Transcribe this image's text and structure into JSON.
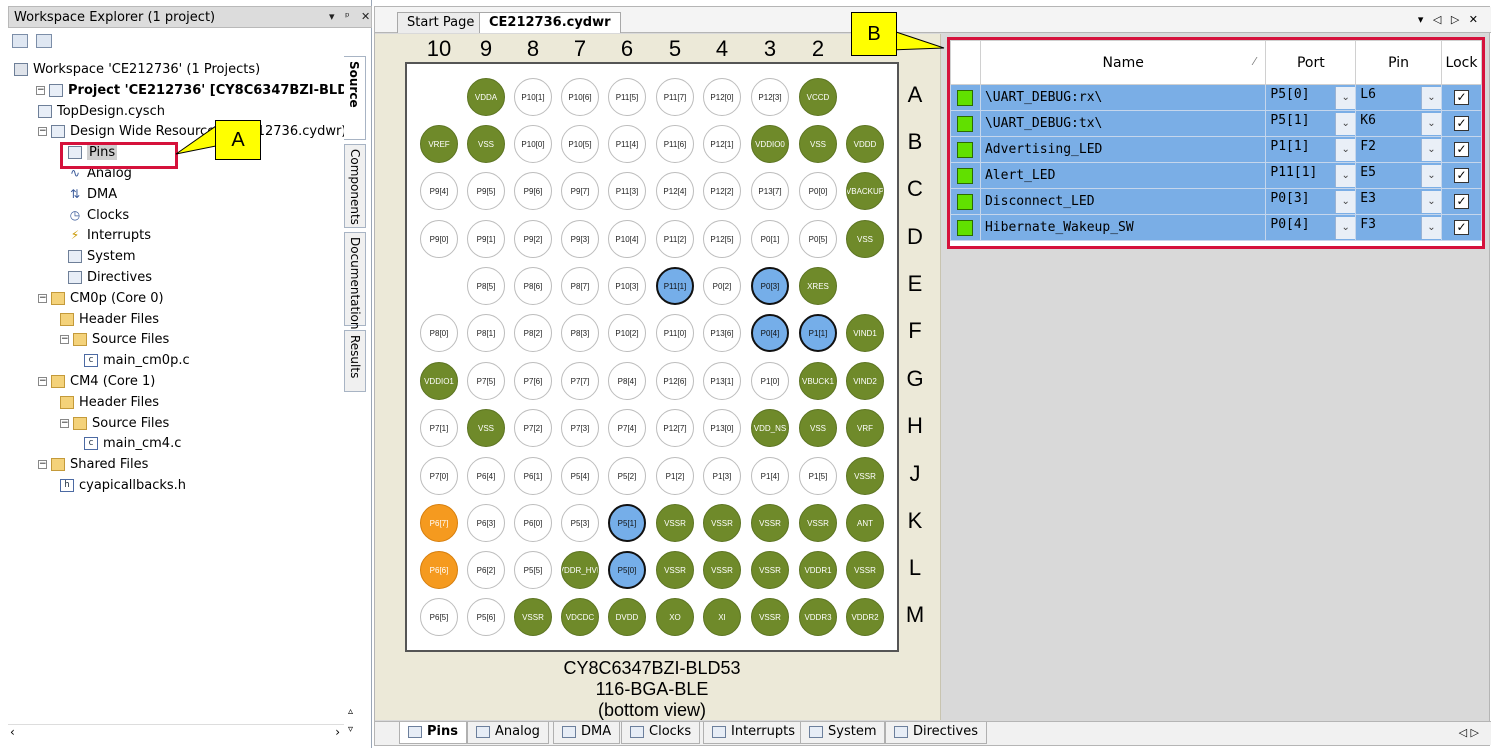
{
  "explorer": {
    "title": "Workspace Explorer (1 project)",
    "controls": {
      "dropdown": "▾",
      "pin": "ᵖ",
      "close": "✕"
    },
    "tree": [
      {
        "label": "Workspace 'CE212736' (1 Projects)",
        "icon": "workspace-icon",
        "bold": false
      },
      {
        "label": "Project  'CE212736' [CY8C6347BZI-BLD53]",
        "icon": "project-icon",
        "bold": true
      },
      {
        "label": "TopDesign.cysch",
        "icon": "schematic-icon",
        "bold": false
      },
      {
        "label": "Design Wide Resources (CE212736.cydwr)",
        "icon": "resources-icon",
        "bold": false
      },
      {
        "label": "Pins",
        "icon": "chip-icon",
        "bold": false
      },
      {
        "label": "Analog",
        "icon": "analog-icon",
        "bold": false
      },
      {
        "label": "DMA",
        "icon": "dma-icon",
        "bold": false
      },
      {
        "label": "Clocks",
        "icon": "clock-icon",
        "bold": false
      },
      {
        "label": "Interrupts",
        "icon": "interrupt-icon",
        "bold": false
      },
      {
        "label": "System",
        "icon": "system-icon",
        "bold": false
      },
      {
        "label": "Directives",
        "icon": "directives-icon",
        "bold": false
      },
      {
        "label": "CM0p (Core 0)",
        "icon": "folder-icon",
        "bold": false
      },
      {
        "label": "Header Files",
        "icon": "folder-icon",
        "bold": false
      },
      {
        "label": "Source Files",
        "icon": "folder-icon",
        "bold": false
      },
      {
        "label": "main_cm0p.c",
        "icon": "c-file-icon",
        "bold": false
      },
      {
        "label": "CM4 (Core 1)",
        "icon": "folder-icon",
        "bold": false
      },
      {
        "label": "Header Files",
        "icon": "folder-icon",
        "bold": false
      },
      {
        "label": "Source Files",
        "icon": "folder-icon",
        "bold": false
      },
      {
        "label": "main_cm4.c",
        "icon": "c-file-icon",
        "bold": false
      },
      {
        "label": "Shared Files",
        "icon": "folder-icon",
        "bold": false
      },
      {
        "label": "cyapicallbacks.h",
        "icon": "h-file-icon",
        "bold": false
      }
    ],
    "side_tabs": [
      "Source",
      "Components",
      "Documentation",
      "Results"
    ]
  },
  "tabs": [
    "Start Page",
    "CE212736.cydwr"
  ],
  "tab_controls": "▾ ◁ ▷ ✕",
  "chip": {
    "columns": [
      "10",
      "9",
      "8",
      "7",
      "6",
      "5",
      "4",
      "3",
      "2"
    ],
    "rows": [
      "A",
      "B",
      "C",
      "D",
      "E",
      "F",
      "G",
      "H",
      "J",
      "K",
      "L",
      "M"
    ],
    "pins": [
      [
        "",
        "VDDA",
        "P10[1]",
        "P10[6]",
        "P11[5]",
        "P11[7]",
        "P12[0]",
        "P12[3]",
        "VCCD"
      ],
      [
        "VREF",
        "VSS",
        "P10[0]",
        "P10[5]",
        "P11[4]",
        "P11[6]",
        "P12[1]",
        "VDDIO0",
        "VSS",
        "VDDD"
      ],
      [
        "P9[4]",
        "P9[5]",
        "P9[6]",
        "P9[7]",
        "P11[3]",
        "P12[4]",
        "P12[2]",
        "P13[7]",
        "P0[0]",
        "VBACKUP"
      ],
      [
        "P9[0]",
        "P9[1]",
        "P9[2]",
        "P9[3]",
        "P10[4]",
        "P11[2]",
        "P12[5]",
        "P0[1]",
        "P0[5]",
        "VSS"
      ],
      [
        "",
        "P8[5]",
        "P8[6]",
        "P8[7]",
        "P10[3]",
        "P11[1]",
        "P0[2]",
        "P0[3]",
        "XRES"
      ],
      [
        "P8[0]",
        "P8[1]",
        "P8[2]",
        "P8[3]",
        "P10[2]",
        "P11[0]",
        "P13[6]",
        "P0[4]",
        "P1[1]",
        "VIND1"
      ],
      [
        "VDDIO1",
        "P7[5]",
        "P7[6]",
        "P7[7]",
        "P8[4]",
        "P12[6]",
        "P13[1]",
        "P1[0]",
        "VBUCK1",
        "VIND2"
      ],
      [
        "P7[1]",
        "VSS",
        "P7[2]",
        "P7[3]",
        "P7[4]",
        "P12[7]",
        "P13[0]",
        "VDD_NS",
        "VSS",
        "VRF"
      ],
      [
        "P7[0]",
        "P6[4]",
        "P6[1]",
        "P5[4]",
        "P5[2]",
        "P1[2]",
        "P1[3]",
        "P1[4]",
        "P1[5]",
        "VSSR"
      ],
      [
        "P6[7]",
        "P6[3]",
        "P6[0]",
        "P5[3]",
        "P5[1]",
        "VSSR",
        "VSSR",
        "VSSR",
        "VSSR",
        "ANT"
      ],
      [
        "P6[6]",
        "P6[2]",
        "P5[5]",
        "VDDR_HVL",
        "P5[0]",
        "VSSR",
        "VSSR",
        "VSSR",
        "VDDR1",
        "VSSR"
      ],
      [
        "P6[5]",
        "P5[6]",
        "VSSR",
        "VDCDC",
        "DVDD",
        "XO",
        "XI",
        "VSSR",
        "VDDR3",
        "VDDR2"
      ]
    ],
    "part_line1": "CY8C6347BZI-BLD53",
    "part_line2": "116-BGA-BLE",
    "part_line3": "(bottom view)"
  },
  "table": {
    "headers": {
      "name": "Name",
      "port": "Port",
      "pin": "Pin",
      "lock": "Lock"
    },
    "sort_glyph": "⁄",
    "rows": [
      {
        "name": "\\UART_DEBUG:rx\\",
        "port": "P5[0]",
        "pin": "L6",
        "lock": "✓"
      },
      {
        "name": "\\UART_DEBUG:tx\\",
        "port": "P5[1]",
        "pin": "K6",
        "lock": "✓"
      },
      {
        "name": "Advertising_LED",
        "port": "P1[1]",
        "pin": "F2",
        "lock": "✓"
      },
      {
        "name": "Alert_LED",
        "port": "P11[1]",
        "pin": "E5",
        "lock": "✓"
      },
      {
        "name": "Disconnect_LED",
        "port": "P0[3]",
        "pin": "E3",
        "lock": "✓"
      },
      {
        "name": "Hibernate_Wakeup_SW",
        "port": "P0[4]",
        "pin": "F3",
        "lock": "✓"
      }
    ]
  },
  "bottom_tabs": [
    "Pins",
    "Analog",
    "DMA",
    "Clocks",
    "Interrupts",
    "System",
    "Directives"
  ],
  "bottom_nav": "◁ ▷",
  "callouts": {
    "a": "A",
    "b": "B"
  },
  "colors": {
    "assigned": "#75aee9",
    "power": "#6f8a2a",
    "warn": "#f59a1f",
    "highlight": "#d5113b",
    "callout": "#ffff00"
  }
}
